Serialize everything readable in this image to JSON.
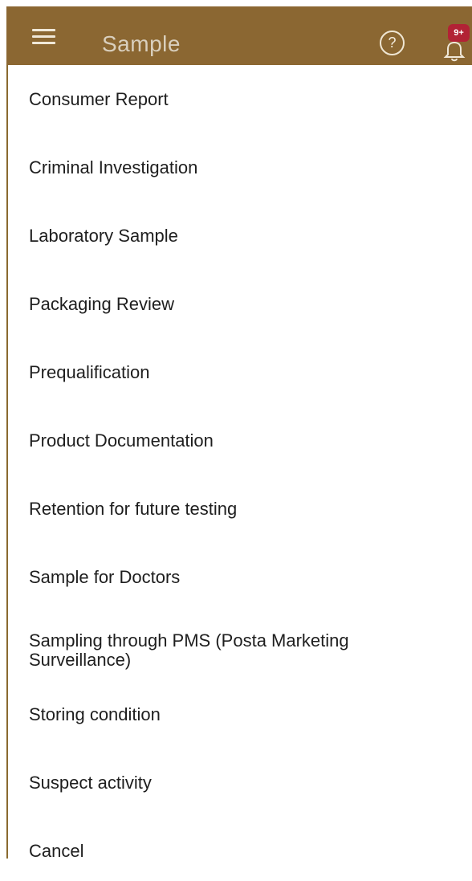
{
  "header": {
    "title": "Sample",
    "menu_icon": "hamburger-menu-icon",
    "help_icon": "help-circle-icon",
    "help_glyph": "?",
    "notification_icon": "bell-icon",
    "notification_badge": "9+",
    "background_color": "#8b6732",
    "badge_color": "#b22235"
  },
  "options": [
    {
      "label": "Consumer Report"
    },
    {
      "label": "Criminal Investigation"
    },
    {
      "label": "Laboratory Sample"
    },
    {
      "label": "Packaging Review"
    },
    {
      "label": "Prequalification"
    },
    {
      "label": "Product Documentation"
    },
    {
      "label": "Retention for future testing"
    },
    {
      "label": "Sample for Doctors"
    },
    {
      "label": "Sampling through PMS (Posta Marketing Surveillance)"
    },
    {
      "label": "Storing condition"
    },
    {
      "label": "Suspect activity"
    },
    {
      "label": "Cancel"
    }
  ]
}
